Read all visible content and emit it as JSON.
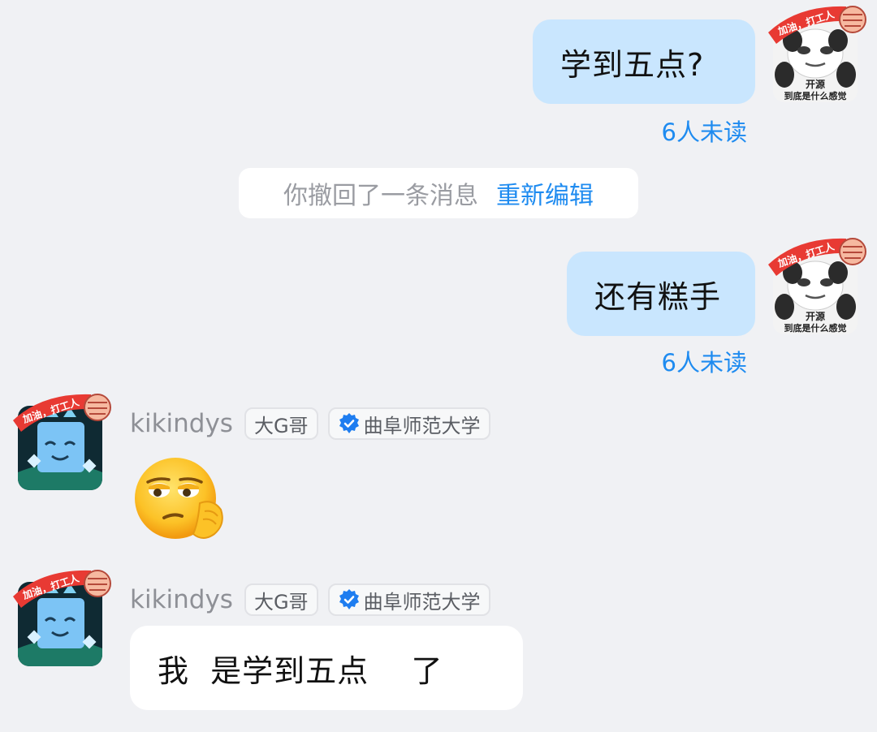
{
  "messages": [
    {
      "text": "学到五点?",
      "read_status": "6人未读"
    },
    {
      "text": "还有糕手",
      "read_status": "6人未读"
    }
  ],
  "system_notice": {
    "text": "你撤回了一条消息",
    "action": "重新编辑"
  },
  "others": [
    {
      "name": "kikindys",
      "title_tag": "大G哥",
      "school_tag": "曲阜师范大学",
      "content": "emoji"
    },
    {
      "name": "kikindys",
      "title_tag": "大G哥",
      "school_tag": "曲阜师范大学",
      "text": "我  是学到五点    了"
    }
  ],
  "avatar_self": {
    "caption_top": "开源",
    "caption_bottom": "到底是什么感觉"
  },
  "avatar_frame_text": "加油，打工人",
  "colors": {
    "self_bubble": "#c9e6fe",
    "other_bubble": "#ffffff",
    "background": "#f0f1f4",
    "accent": "#1e8bf0"
  }
}
